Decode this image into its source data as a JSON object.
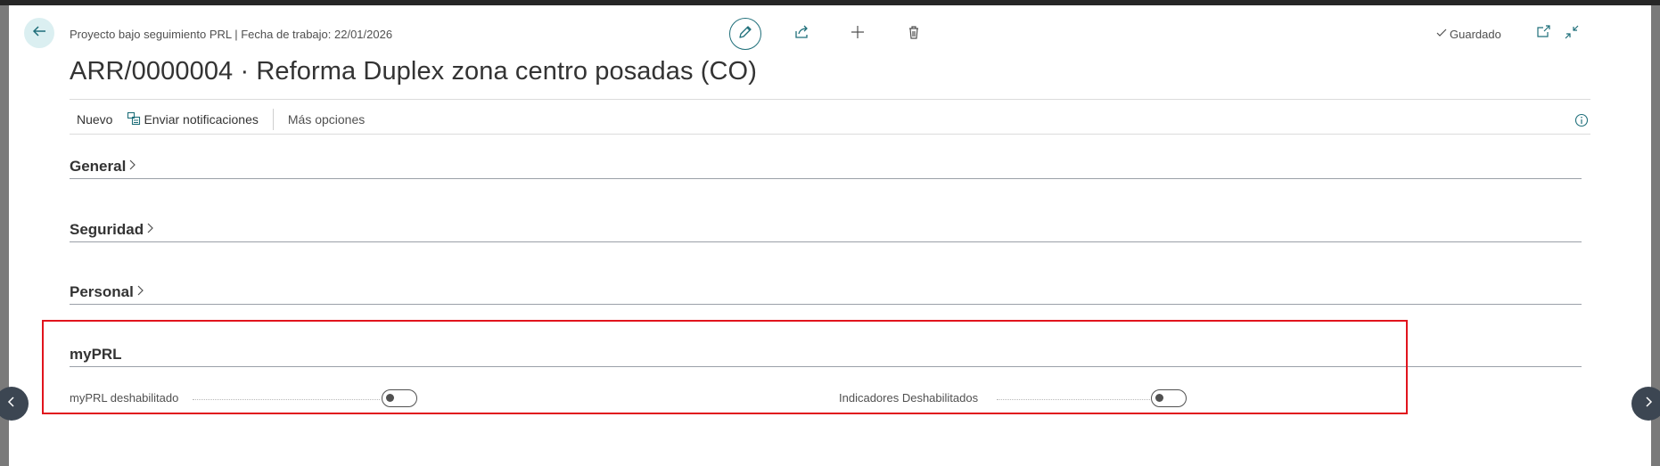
{
  "header": {
    "caption": "Proyecto bajo seguimiento PRL | Fecha de trabajo: 22/01/2026",
    "title": "ARR/0000004 · Reforma Duplex zona centro posadas (CO)",
    "saved_label": "Guardado"
  },
  "toolbar": {
    "edit_icon": "pencil-icon",
    "share_icon": "share-icon",
    "add_icon": "plus-icon",
    "delete_icon": "trash-icon"
  },
  "actions": {
    "new_label": "Nuevo",
    "send_notifications_label": "Enviar notificaciones",
    "more_options_label": "Más opciones"
  },
  "sections": {
    "general": "General",
    "seguridad": "Seguridad",
    "personal": "Personal",
    "myprl": "myPRL"
  },
  "fields": {
    "myprl_disabled": {
      "label": "myPRL deshabilitado",
      "value": false
    },
    "indicators_disabled": {
      "label": "Indicadores Deshabilitados",
      "value": false
    }
  },
  "colors": {
    "accent": "#1f6f7a",
    "highlight": "#e1141d",
    "back_button_bg": "#dbeff1",
    "nav_circle": "#3c4652"
  }
}
